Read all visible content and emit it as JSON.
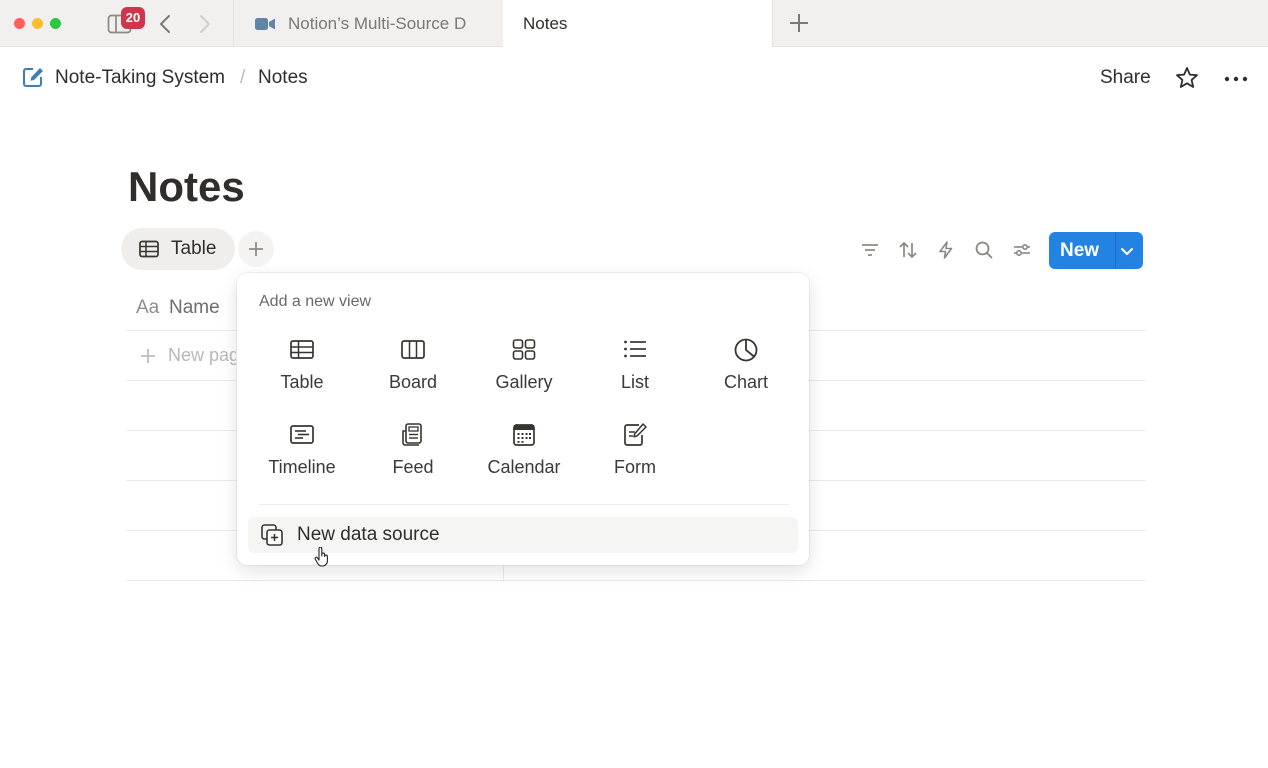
{
  "browser": {
    "badge_count": "20",
    "tabs": [
      {
        "title": "Notion’s Multi-Source D",
        "icon": "video-camera-icon"
      },
      {
        "title": "Notes"
      }
    ]
  },
  "breadcrumb": {
    "workspace": "Note-Taking System",
    "separator": "/",
    "page": "Notes"
  },
  "header": {
    "share_label": "Share"
  },
  "page": {
    "title": "Notes"
  },
  "views": {
    "active_view": "Table"
  },
  "toolbar": {
    "new_label": "New"
  },
  "table": {
    "name_type_icon": "Aa",
    "name_column": "Name",
    "new_page_label": "New page"
  },
  "add_view_menu": {
    "title": "Add a new view",
    "options": [
      {
        "label": "Table",
        "icon": "table-icon"
      },
      {
        "label": "Board",
        "icon": "board-icon"
      },
      {
        "label": "Gallery",
        "icon": "gallery-icon"
      },
      {
        "label": "List",
        "icon": "list-icon"
      },
      {
        "label": "Chart",
        "icon": "chart-icon"
      },
      {
        "label": "Timeline",
        "icon": "timeline-icon"
      },
      {
        "label": "Feed",
        "icon": "feed-icon"
      },
      {
        "label": "Calendar",
        "icon": "calendar-icon"
      },
      {
        "label": "Form",
        "icon": "form-icon"
      }
    ],
    "new_data_source_label": "New data source"
  },
  "colors": {
    "accent": "#2383e2",
    "badge": "#d0364b"
  }
}
